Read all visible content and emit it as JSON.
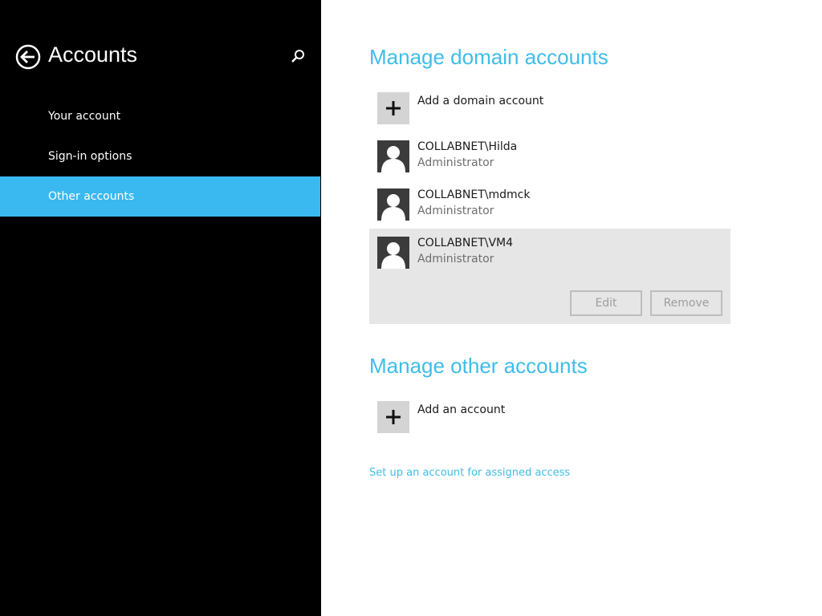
{
  "sidebar": {
    "title": "Accounts",
    "items": [
      {
        "label": "Your account"
      },
      {
        "label": "Sign-in options"
      },
      {
        "label": "Other accounts"
      }
    ]
  },
  "domain_section": {
    "title": "Manage domain accounts",
    "add_label": "Add a domain account",
    "accounts": [
      {
        "name": "COLLABNET\\Hilda",
        "role": "Administrator"
      },
      {
        "name": "COLLABNET\\mdmck",
        "role": "Administrator"
      },
      {
        "name": "COLLABNET\\VM4",
        "role": "Administrator"
      }
    ],
    "edit_label": "Edit",
    "remove_label": "Remove"
  },
  "other_section": {
    "title": "Manage other accounts",
    "add_label": "Add an account"
  },
  "assigned_access_link": "Set up an account for assigned access",
  "colors": {
    "accent": "#3fbde8",
    "selected_nav": "#3ab8f0",
    "sidebar_bg": "#000000"
  },
  "icons": [
    "back-arrow-icon",
    "search-icon",
    "plus-icon",
    "user-avatar-icon"
  ]
}
